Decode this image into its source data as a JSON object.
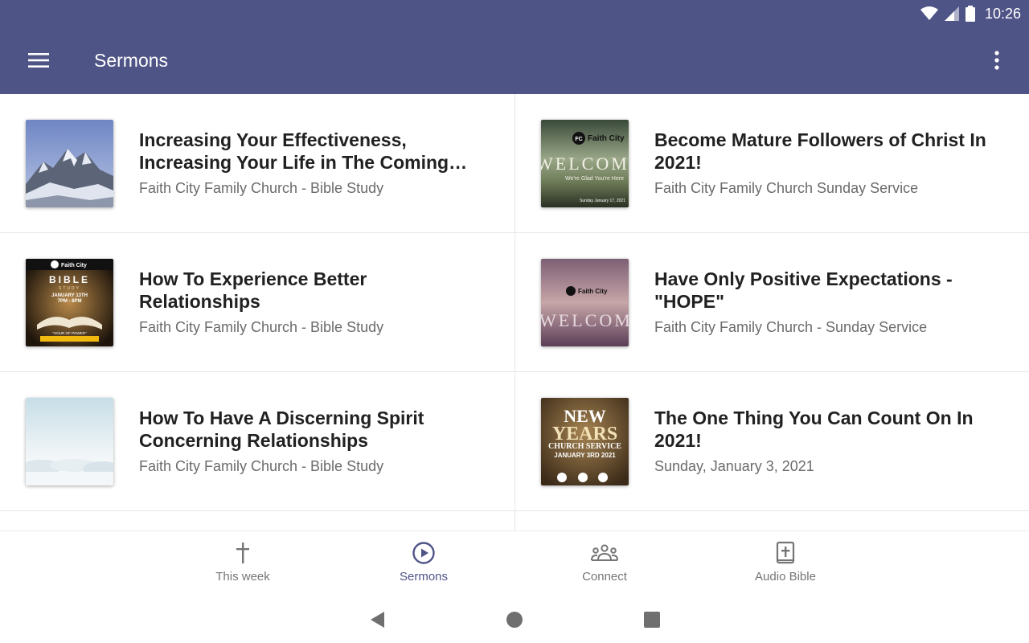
{
  "status": {
    "time": "10:26"
  },
  "appbar": {
    "title": "Sermons"
  },
  "sermons": [
    {
      "title": "Increasing Your Effectiveness, Increasing Your Life in The Coming Ye…",
      "subtitle": "Faith City Family Church - Bible Study"
    },
    {
      "title": "Become Mature Followers of Christ In 2021!",
      "subtitle": "Faith City Family Church Sunday Service"
    },
    {
      "title": "How To Experience Better Relationships",
      "subtitle": "Faith City Family Church - Bible Study"
    },
    {
      "title": "Have Only Positive Expectations -\"HOPE\"",
      "subtitle": "Faith City Family Church - Sunday Service"
    },
    {
      "title": "How To Have A Discerning Spirit Concerning Relationships",
      "subtitle": "Faith City Family Church - Bible Study"
    },
    {
      "title": "The One Thing You Can Count On In 2021!",
      "subtitle": "Sunday, January 3, 2021"
    }
  ],
  "thumbs": {
    "welcome_brand": "Faith City",
    "welcome_word": "WELCOME",
    "welcome_tagline": "We're Glad You're Here",
    "welcome_date": "Sunday January 17, 2021",
    "bible_brand": "Faith City",
    "bible_word": "BIBLE",
    "bible_sub": "STUDY",
    "bible_date": "JANUARY 13TH",
    "bible_time": "7PM - 8PM",
    "bible_hour": "\"HOUR OF POWER\"",
    "newyears_line1": "NEW",
    "newyears_line2": "YEARS",
    "newyears_line3": "CHURCH SERVICE",
    "newyears_date": "JANUARY 3RD 2021"
  },
  "nav": {
    "items": [
      {
        "label": "This week",
        "icon": "cross-icon"
      },
      {
        "label": "Sermons",
        "icon": "play-circle-icon"
      },
      {
        "label": "Connect",
        "icon": "group-icon"
      },
      {
        "label": "Audio Bible",
        "icon": "bible-icon"
      }
    ],
    "active": "Sermons"
  },
  "colors": {
    "appbar": "#4f5487",
    "accent": "#4f5487"
  }
}
